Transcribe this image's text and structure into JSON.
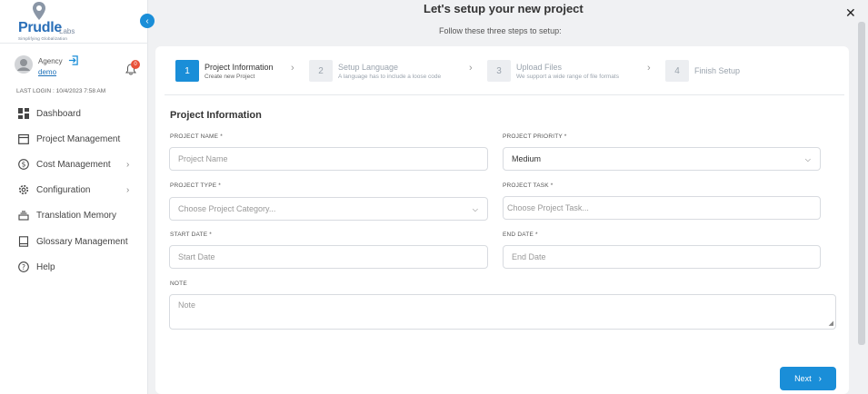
{
  "sidebar": {
    "logo_name": "Prudle",
    "logo_labs": "Labs",
    "logo_tagline": "Simplifying Globalization",
    "user_role": "Agency",
    "user_name": "demo",
    "notification_count": "0",
    "last_login": "LAST LOGIN : 10/4/2023 7:58 AM",
    "nav": [
      {
        "label": "Dashboard",
        "icon": "dashboard-icon",
        "chevron": false
      },
      {
        "label": "Project Management",
        "icon": "calendar-icon",
        "chevron": false
      },
      {
        "label": "Cost Management",
        "icon": "dollar-icon",
        "chevron": true
      },
      {
        "label": "Configuration",
        "icon": "gear-icon",
        "chevron": true
      },
      {
        "label": "Translation Memory",
        "icon": "stack-icon",
        "chevron": false
      },
      {
        "label": "Glossary Management",
        "icon": "book-icon",
        "chevron": false
      },
      {
        "label": "Help",
        "icon": "help-icon",
        "chevron": false
      }
    ]
  },
  "header": {
    "title": "Let's setup your new project",
    "subtitle": "Follow these three steps to setup:"
  },
  "steps": [
    {
      "num": "1",
      "title": "Project Information",
      "desc": "Create new Project",
      "active": true
    },
    {
      "num": "2",
      "title": "Setup Language",
      "desc": "A language has to include a loose code",
      "active": false
    },
    {
      "num": "3",
      "title": "Upload Files",
      "desc": "We support a wide range of file formats",
      "active": false
    },
    {
      "num": "4",
      "title": "Finish Setup",
      "desc": "",
      "active": false
    }
  ],
  "form": {
    "section_title": "Project Information",
    "project_name_label": "PROJECT NAME *",
    "project_name_placeholder": "Project Name",
    "project_priority_label": "PROJECT PRIORITY *",
    "project_priority_value": "Medium",
    "project_type_label": "PROJECT TYPE *",
    "project_type_placeholder": "Choose Project Category...",
    "project_task_label": "PROJECT TASK *",
    "project_task_placeholder": "Choose Project Task...",
    "start_date_label": "START DATE *",
    "start_date_placeholder": "Start Date",
    "end_date_label": "END DATE *",
    "end_date_placeholder": "End Date",
    "note_label": "NOTE",
    "note_placeholder": "Note",
    "next_label": "Next"
  },
  "colors": {
    "accent": "#1a8ed8",
    "badge": "#e8523a"
  }
}
